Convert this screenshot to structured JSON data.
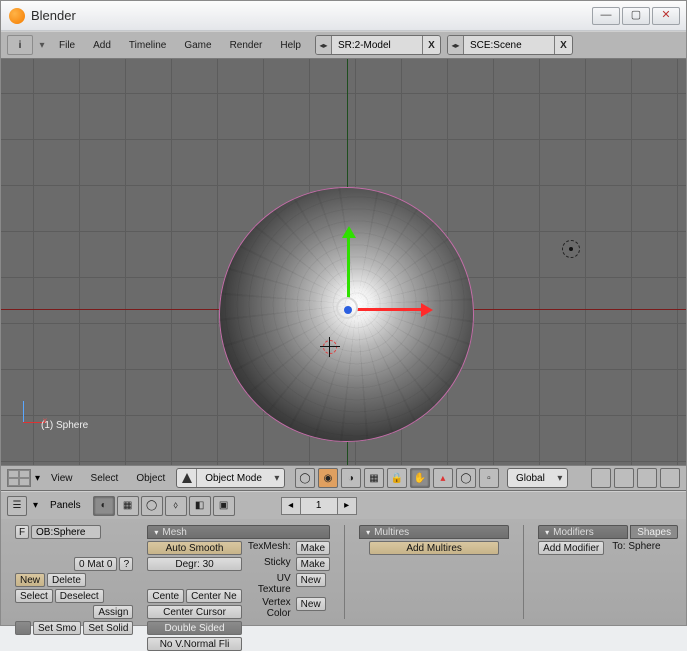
{
  "window": {
    "title": "Blender"
  },
  "menubar": {
    "items": [
      "File",
      "Add",
      "Timeline",
      "Game",
      "Render",
      "Help"
    ],
    "screen_selector": "SR:2-Model",
    "scene_selector": "SCE:Scene"
  },
  "viewport": {
    "overlay_label": "(1) Sphere",
    "axis_widget": {
      "x": "x"
    }
  },
  "view_toolbar": {
    "menus": [
      "View",
      "Select",
      "Object"
    ],
    "mode": "Object Mode",
    "orientation": "Global"
  },
  "panels_bar": {
    "label": "Panels",
    "page": "1"
  },
  "buttons": {
    "link_ob": {
      "prefix": "F",
      "value": "OB:Sphere"
    },
    "mat": {
      "label": "0 Mat 0",
      "q": "?"
    },
    "new": "New",
    "delete": "Delete",
    "select_btn": "Select",
    "deselect": "Deselect",
    "assign": "Assign",
    "set_smooth": "Set Smo",
    "set_solid": "Set Solid",
    "mesh_panel": "Mesh",
    "auto_smooth": "Auto Smooth",
    "degr": "Degr: 30",
    "texmesh_label": "TexMesh:",
    "make": "Make",
    "sticky": "Sticky",
    "uv_texture": "UV Texture",
    "uv_new": "New",
    "vertex_color": "Vertex Color",
    "vc_new": "New",
    "center": "Cente",
    "center_new": "Center Ne",
    "center_cursor": "Center Cursor",
    "double_sided": "Double Sided",
    "no_vnormal": "No V.Normal Fli",
    "multires_panel": "Multires",
    "add_multires": "Add Multires",
    "modifiers_panel": "Modifiers",
    "add_modifier": "Add Modifier",
    "to_sphere": "To: Sphere",
    "shapes_panel": "Shapes"
  }
}
